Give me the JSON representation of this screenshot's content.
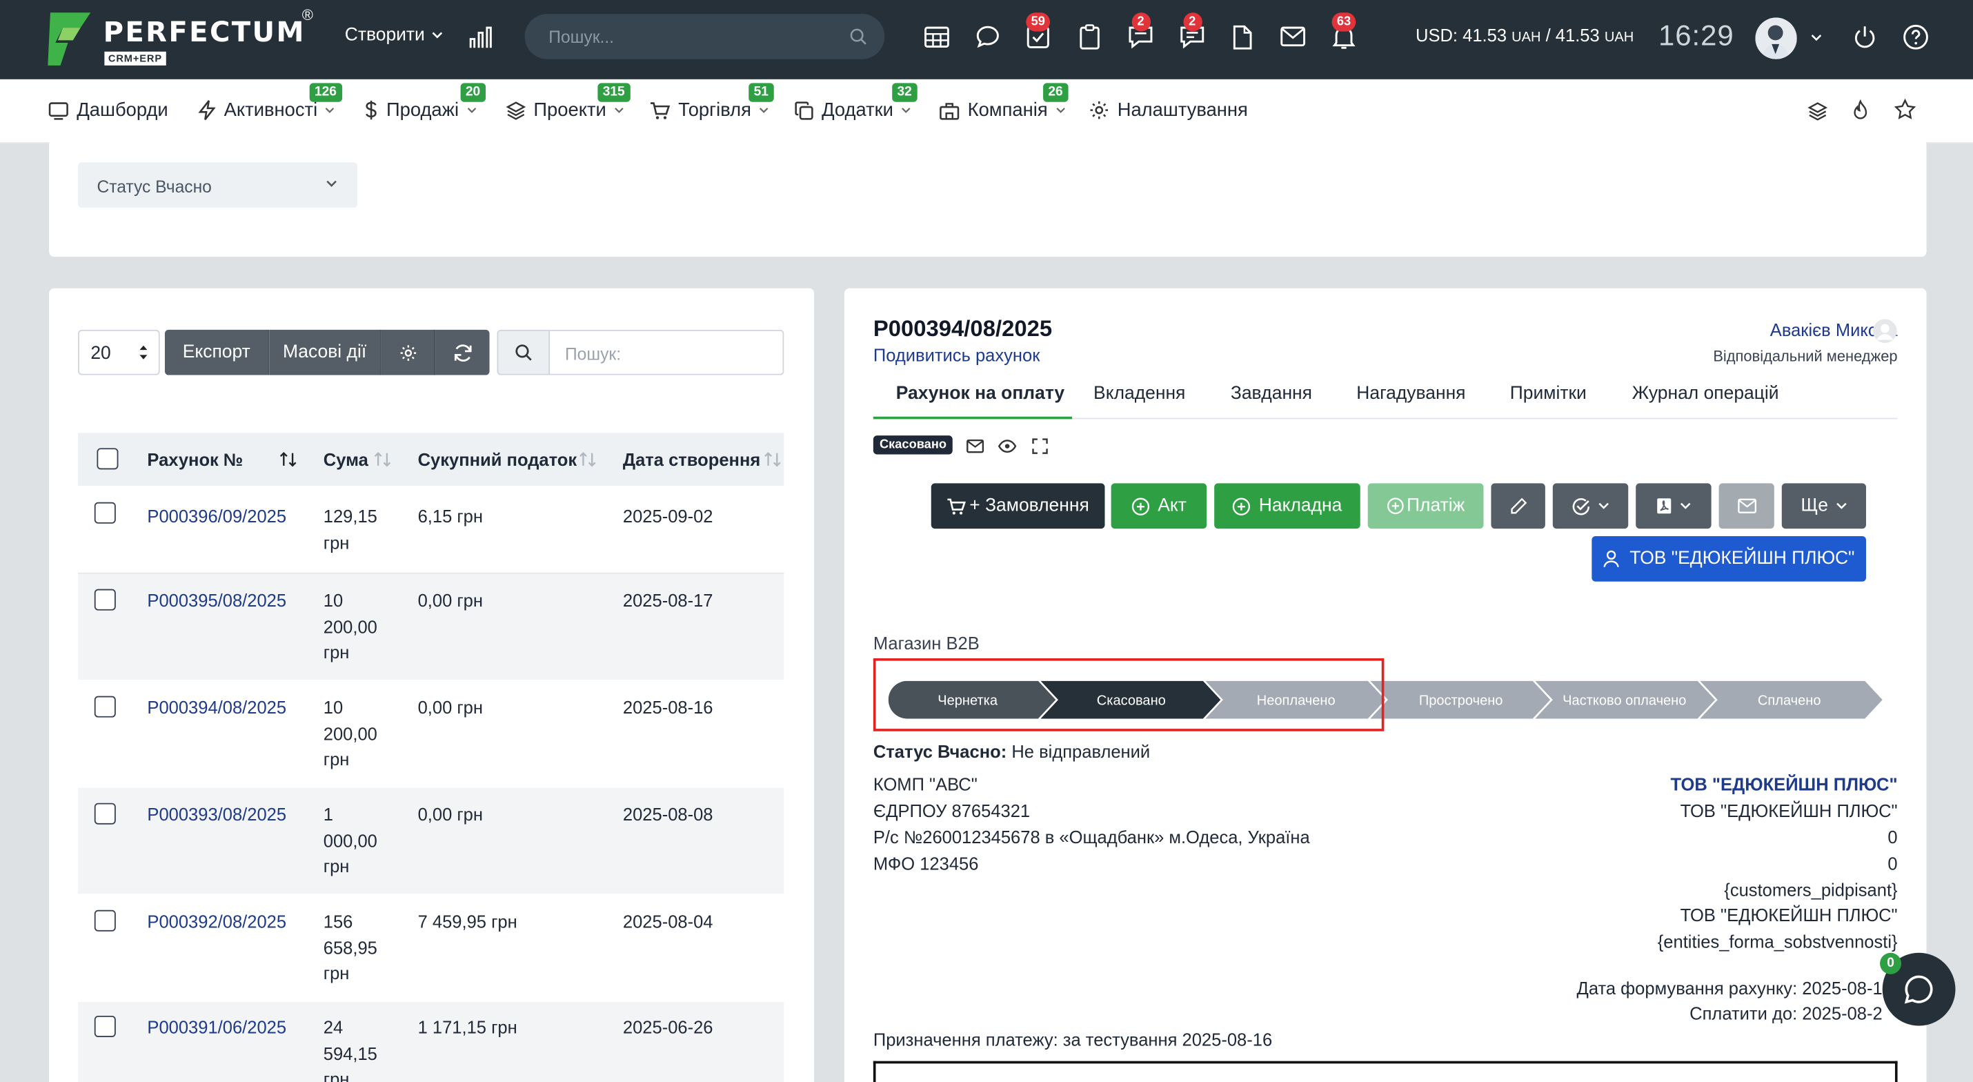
{
  "topbar": {
    "logo_text": "PERFECTUM",
    "logo_sub": "CRM+ERP",
    "logo_reg": "®",
    "create_label": "Створити",
    "search_placeholder": "Пошук...",
    "badges": {
      "tasks": "59",
      "chat": "2",
      "messages": "2",
      "notifications": "63"
    },
    "usd_label": "USD:",
    "usd_value": "41.53",
    "usd_unit": "UAH",
    "usd_sep": "/",
    "usd_value2": "41.53",
    "usd_unit2": "UAH",
    "time": "16:29"
  },
  "nav": [
    {
      "label": "Дашборди",
      "badge": "",
      "icon": "dashboard-icon"
    },
    {
      "label": "Активності",
      "badge": "126",
      "icon": "lightning-icon"
    },
    {
      "label": "Продажі",
      "badge": "20",
      "icon": "dollar-icon"
    },
    {
      "label": "Проекти",
      "badge": "315",
      "icon": "layers-icon"
    },
    {
      "label": "Торгівля",
      "badge": "51",
      "icon": "cart-icon"
    },
    {
      "label": "Додатки",
      "badge": "32",
      "icon": "copy-icon"
    },
    {
      "label": "Компанія",
      "badge": "26",
      "icon": "building-icon"
    },
    {
      "label": "Налаштування",
      "badge": "",
      "icon": "gear-icon"
    }
  ],
  "filter": {
    "status_select": "Статус Вчасно"
  },
  "list": {
    "page_size": "20",
    "export": "Експорт",
    "bulk": "Масові дії",
    "search_placeholder": "Пошук:",
    "columns": [
      "Рахунок №",
      "Сума",
      "Сукупний податок",
      "Дата створення"
    ],
    "rows": [
      {
        "number": "P000396/09/2025",
        "sum": [
          "129,15",
          "грн"
        ],
        "tax": "6,15 грн",
        "date": "2025-09-02"
      },
      {
        "number": "P000395/08/2025",
        "sum": [
          "10",
          "200,00",
          "грн"
        ],
        "tax": "0,00 грн",
        "date": "2025-08-17"
      },
      {
        "number": "P000394/08/2025",
        "sum": [
          "10",
          "200,00",
          "грн"
        ],
        "tax": "0,00 грн",
        "date": "2025-08-16"
      },
      {
        "number": "P000393/08/2025",
        "sum": [
          "1",
          "000,00",
          "грн"
        ],
        "tax": "0,00 грн",
        "date": "2025-08-08"
      },
      {
        "number": "P000392/08/2025",
        "sum": [
          "156",
          "658,95",
          "грн"
        ],
        "tax": "7 459,95 грн",
        "date": "2025-08-04"
      },
      {
        "number": "P000391/06/2025",
        "sum": [
          "24",
          "594,15",
          "грн"
        ],
        "tax": "1 171,15 грн",
        "date": "2025-06-26"
      }
    ]
  },
  "invoice": {
    "number": "P000394/08/2025",
    "view_link": "Подивитись рахунок",
    "manager_name": "Авакієв Микола",
    "manager_role": "Відповідальний менеджер",
    "tabs": [
      "Рахунок на оплату",
      "Вкладення",
      "Завдання",
      "Нагадування",
      "Примітки",
      "Журнал операцій"
    ],
    "status_badge": "Скасовано",
    "buttons": {
      "order": "+ Замовлення",
      "act": "Акт",
      "waybill": "Накладна",
      "payment": "Платіж",
      "more": "Ще"
    },
    "customer_button": "ТОВ \"ЕДЮКЕЙШН ПЛЮС\"",
    "shop": "Магазин B2B",
    "pipeline": [
      "Чернетка",
      "Скасовано",
      "Неоплачено",
      "Прострочено",
      "Частково оплачено",
      "Сплачено"
    ],
    "status_vchasno_label": "Статус Вчасно:",
    "status_vchasno_value": "Не відправлений",
    "seller": [
      "КОМП \"АВС\"",
      "ЄДРПОУ 87654321",
      "Р/с №260012345678 в «Ощадбанк» м.Одеса, Україна",
      "МФО 123456"
    ],
    "buyer_title": "ТОВ \"ЕДЮКЕЙШН ПЛЮС\"",
    "buyer": [
      "ТОВ \"ЕДЮКЕЙШН ПЛЮС\"",
      "0",
      "0",
      "{customers_pidpisant}",
      "ТОВ \"ЕДЮКЕЙШН ПЛЮС\"",
      "{entities_forma_sobstvennosti}"
    ],
    "date_formed": "Дата формування рахунку: 2025-08-1",
    "pay_until": "Сплатити до: 2025-08-2",
    "purpose": "Призначення платежу: за тестування 2025-08-16"
  },
  "chat": {
    "badge": "0"
  }
}
